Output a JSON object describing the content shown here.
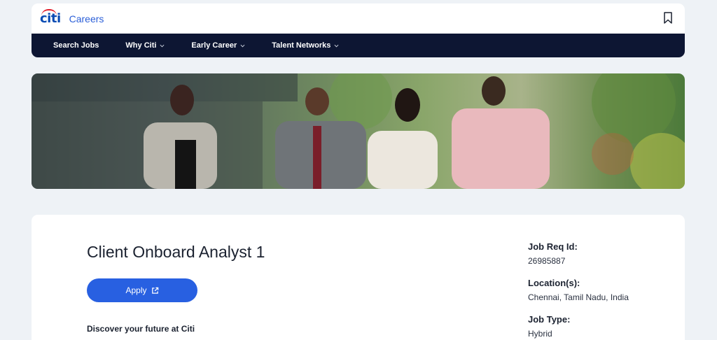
{
  "header": {
    "brand": "citi",
    "section": "Careers"
  },
  "nav": {
    "items": [
      {
        "label": "Search Jobs",
        "has_dropdown": false
      },
      {
        "label": "Why Citi",
        "has_dropdown": true
      },
      {
        "label": "Early Career",
        "has_dropdown": true
      },
      {
        "label": "Talent Networks",
        "has_dropdown": true
      }
    ]
  },
  "job": {
    "title": "Client Onboard Analyst 1",
    "apply_label": "Apply",
    "discover_heading": "Discover your future at Citi"
  },
  "details": {
    "req_id_label": "Job Req Id:",
    "req_id_value": "26985887",
    "location_label": "Location(s):",
    "location_value": "Chennai, Tamil Nadu, India",
    "job_type_label": "Job Type:",
    "job_type_value": "Hybrid"
  },
  "colors": {
    "accent": "#2860e1",
    "nav_bg": "#0d1633",
    "brand_red": "#e11d2a",
    "brand_blue": "#0a4bb3",
    "page_bg": "#eef2f6"
  }
}
